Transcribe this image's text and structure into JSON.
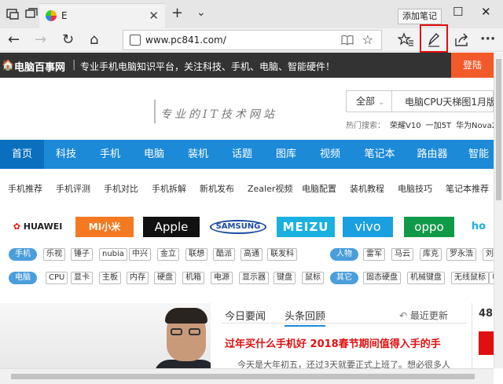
{
  "browser": {
    "tab_title": "E",
    "tab_close": "✕",
    "new_tab": "+",
    "tab_list": "⌄",
    "tooltip": "添加笔记",
    "win_min": "—",
    "win_max": "☐",
    "win_close": "✕",
    "url": "www.pc841.com/",
    "back": "←",
    "forward": "→",
    "refresh": "↻",
    "home": "⌂",
    "reading_view": "📖",
    "favorite": "☆",
    "hub": "☆≡",
    "web_note": "✎",
    "share": "⇪",
    "more": "···",
    "highlight_color": "#e01010"
  },
  "site": {
    "home_icon": "🏠",
    "brand": "电脑百事网",
    "separator": "|",
    "slogan": "专业手机电脑知识平台，关注科技、手机、电脑、智能硬件！",
    "login": "登陆",
    "handwritten_logo": "专业的IT技术网站",
    "search_category": "全部",
    "search_query": "电脑CPU天梯图1月版",
    "hot_label": "热门搜索：",
    "hot_items": [
      "荣耀V10",
      "一加5T",
      "华为Nova2s"
    ],
    "menu": [
      "首页",
      "科技",
      "手机",
      "电脑",
      "装机",
      "话题",
      "图库",
      "视频",
      "笔记本",
      "路由器",
      "智能"
    ],
    "subnav": [
      "手机推荐",
      "手机评测",
      "手机对比",
      "手机拆解",
      "新机发布",
      "Zealer视频",
      "电脑配置",
      "装机教程",
      "电脑技巧",
      "笔记本推荐"
    ],
    "brands": [
      "HUAWEI",
      "MI小米",
      "Apple",
      "SAMSUNG",
      "MEIZU",
      "vivo",
      "oppo",
      "ho"
    ],
    "tags_row1": [
      "手机",
      "乐视",
      "锤子",
      "nubia",
      "中兴",
      "金立",
      "联想",
      "酷派",
      "高通",
      "联发科",
      "人物",
      "雷军",
      "马云",
      "库克",
      "罗永浩",
      "刘"
    ],
    "tags_row2": [
      "电脑",
      "CPU",
      "显卡",
      "主板",
      "内存",
      "硬盘",
      "机箱",
      "电源",
      "显示器",
      "键盘",
      "鼠标",
      "其它",
      "固态硬盘",
      "机械键盘",
      "无线鼠标",
      "电"
    ],
    "news_tab1": "今日要闻",
    "news_tab2": "头条回顾",
    "refresh_news": "最近更新",
    "headline": "过年买什么手机好 2018春节期间值得入手的手",
    "summary": "今天是大年初五，还过3天就要正式上班了。想必很多人",
    "right_num": "48"
  }
}
